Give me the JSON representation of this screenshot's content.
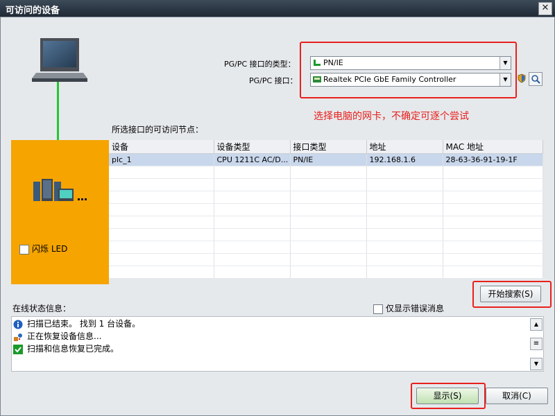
{
  "window": {
    "title": "可访问的设备",
    "close": "✕"
  },
  "interface": {
    "type_label": "PG/PC 接口的类型：",
    "type_value": "PN/IE",
    "port_label": "PG/PC 接口：",
    "port_value": "Realtek PCIe GbE Family Controller"
  },
  "annotation": "选择电脑的网卡，不确定可逐个尝试",
  "nodes_label": "所选接口的可访问节点：",
  "flash_led": "闪烁 LED",
  "table": {
    "headers": [
      "设备",
      "设备类型",
      "接口类型",
      "地址",
      "MAC 地址"
    ],
    "rows": [
      [
        "plc_1",
        "CPU 1211C AC/D...",
        "PN/IE",
        "192.168.1.6",
        "28-63-36-91-19-1F"
      ]
    ]
  },
  "search_button": "开始搜索(S)",
  "status": {
    "label": "在线状态信息：",
    "only_errors": "仅显示错误消息",
    "messages": [
      {
        "icon": "info-icon",
        "text": "扫描已结束。 找到 1 台设备。"
      },
      {
        "icon": "recover-icon",
        "text": "正在恢复设备信息..."
      },
      {
        "icon": "check-icon",
        "text": "扫描和信息恢复已完成。"
      }
    ]
  },
  "buttons": {
    "show": "显示(S)",
    "cancel": "取消(C)"
  },
  "colors": {
    "accent_red": "#e8201c",
    "panel_orange": "#f5a400",
    "link_green": "#22c832"
  }
}
